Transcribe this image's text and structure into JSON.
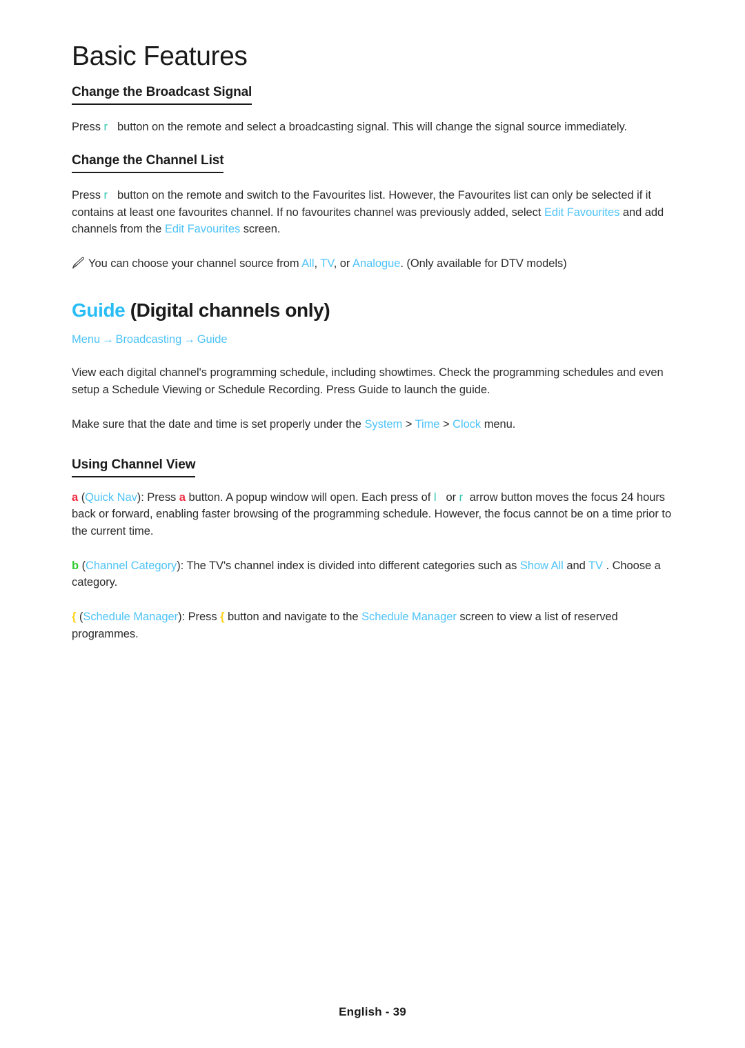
{
  "page": {
    "title": "Basic Features",
    "footer": "English - 39"
  },
  "colors": {
    "link_blue": "#4ec3f7",
    "heading_blue": "#29bdf5",
    "key_teal": "#2ec4b0",
    "key_red": "#f0263c",
    "key_green": "#2ecc2e",
    "key_yellow": "#ffd11a",
    "text": "#2b2b2b"
  },
  "sections": {
    "broadcast_signal": {
      "heading": "Change the Broadcast Signal",
      "para": {
        "p1": "Press",
        "key": "r",
        "p2": "button on the remote and select a broadcasting signal. This will change the signal source immediately."
      }
    },
    "channel_list": {
      "heading": "Change the Channel List",
      "para": {
        "p1": "Press",
        "key": "r",
        "p2": "button on the remote and switch to the Favourites list. However, the Favourites list can only be selected if it contains at least one favourites channel. If no favourites channel was previously added, select",
        "link1": "Edit Favourites",
        "p3": "and add channels from the",
        "link2": "Edit Favourites",
        "p4": "screen."
      },
      "note": {
        "icon": "pencil-icon",
        "p1": "You can choose your channel source from",
        "link1": "All",
        "sep1": ",",
        "link2": "TV",
        "sep2": ", or",
        "link3": "Analogue",
        "p2": ". (Only available for DTV models)"
      }
    },
    "guide": {
      "heading_blue": "Guide",
      "heading_rest": "(Digital channels only)",
      "breadcrumb": {
        "item1": "Menu",
        "arrow1": "→",
        "item2": "Broadcasting",
        "arrow2": "→",
        "item3": "Guide"
      },
      "para1": "View each digital channel's programming schedule, including showtimes. Check the programming schedules and even setup a Schedule Viewing or Schedule Recording. Press Guide to launch the guide.",
      "para2": {
        "p1": "Make sure that the date and time is set properly under the",
        "link1": "System",
        "sep1": ">",
        "link2": "Time",
        "sep2": ">",
        "link3": "Clock",
        "p2": "menu."
      }
    },
    "channel_view": {
      "heading": "Using Channel View",
      "item_a": {
        "key": "a",
        "open": "(",
        "link1": "Quick Nav",
        "close": "): Press",
        "key2": "a",
        "p1": "button. A popup window will open. Each press of",
        "key3": "l",
        "p2": "or",
        "key4": "r",
        "p3": "arrow button moves the focus 24 hours back or forward, enabling faster browsing of the programming schedule. However, the focus cannot be on a time prior to the current time."
      },
      "item_b": {
        "key": "b",
        "open": "(",
        "link1": "Channel Category",
        "close": "): The TV's channel index is divided into different categories such as",
        "link2": "Show All",
        "p1": "and",
        "link3": "TV",
        "p2": ". Choose a category."
      },
      "item_c": {
        "key": "{",
        "open": "(",
        "link1": "Schedule Manager",
        "close": "): Press",
        "key2": "{",
        "p1": "button and navigate to the",
        "link2": "Schedule Manager",
        "p2": "screen to view a list of reserved programmes."
      }
    }
  }
}
